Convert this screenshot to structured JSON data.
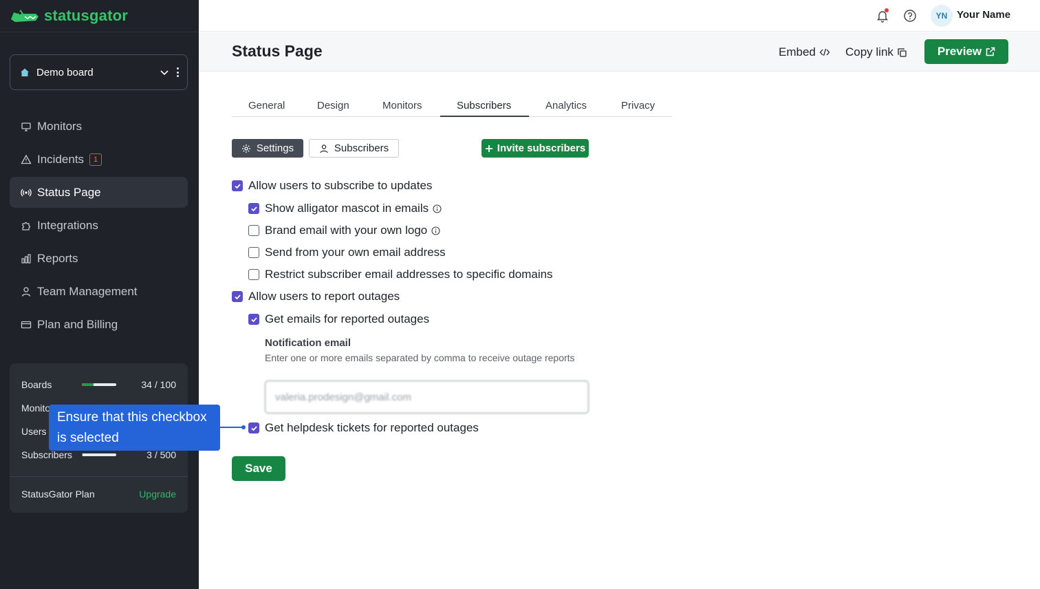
{
  "brand": {
    "name": "statusgator",
    "color": "#35c46a"
  },
  "board": {
    "label": "Demo board"
  },
  "nav": [
    {
      "label": "Monitors",
      "icon": "monitor-icon"
    },
    {
      "label": "Incidents",
      "icon": "warning-icon",
      "badge": "1"
    },
    {
      "label": "Status Page",
      "icon": "broadcast-icon",
      "active": true
    },
    {
      "label": "Integrations",
      "icon": "puzzle-icon"
    },
    {
      "label": "Reports",
      "icon": "bar-chart-icon"
    },
    {
      "label": "Team Management",
      "icon": "user-icon"
    },
    {
      "label": "Plan and Billing",
      "icon": "credit-card-icon"
    }
  ],
  "usage": [
    {
      "name": "Boards",
      "value": "34 / 100",
      "fraction": 0.34
    },
    {
      "name": "Monitors",
      "value": "",
      "fraction": 0
    },
    {
      "name": "Users",
      "value": "",
      "fraction": 0
    },
    {
      "name": "Subscribers",
      "value": "3 / 500",
      "fraction": 0.006
    }
  ],
  "plan": {
    "name": "StatusGator Plan",
    "upgrade": "Upgrade"
  },
  "tooltip": {
    "text": "Ensure that this checkbox is selected"
  },
  "topbar": {
    "initials": "YN",
    "user_name": "Your Name"
  },
  "header": {
    "title": "Status Page",
    "embed": "Embed",
    "copy_link": "Copy link",
    "preview": "Preview"
  },
  "tabs": [
    "General",
    "Design",
    "Monitors",
    "Subscribers",
    "Analytics",
    "Privacy"
  ],
  "active_tab": "Subscribers",
  "subnav": {
    "settings": "Settings",
    "subscribers": "Subscribers",
    "invite": "Invite subscribers"
  },
  "options": {
    "allow_subscribe": {
      "label": "Allow users to subscribe to updates",
      "checked": true
    },
    "mascot": {
      "label": "Show alligator mascot in emails",
      "checked": true
    },
    "brand_logo": {
      "label": "Brand email with your own logo",
      "checked": false
    },
    "own_email": {
      "label": "Send from your own email address",
      "checked": false
    },
    "restrict": {
      "label": "Restrict subscriber email addresses to specific domains",
      "checked": false
    },
    "allow_report": {
      "label": "Allow users to report outages",
      "checked": true
    },
    "get_emails": {
      "label": "Get emails for reported outages",
      "checked": true
    },
    "helpdesk": {
      "label": "Get helpdesk tickets for reported outages",
      "checked": true
    }
  },
  "notification": {
    "title": "Notification email",
    "description": "Enter one or more emails separated by comma to receive outage reports",
    "value": "valeria.prodesign@gmail.com"
  },
  "save_label": "Save",
  "colors": {
    "primary": "#178544",
    "checkbox": "#5b4fc9",
    "sidebar": "#1f2329",
    "tooltip": "#2563d9"
  }
}
